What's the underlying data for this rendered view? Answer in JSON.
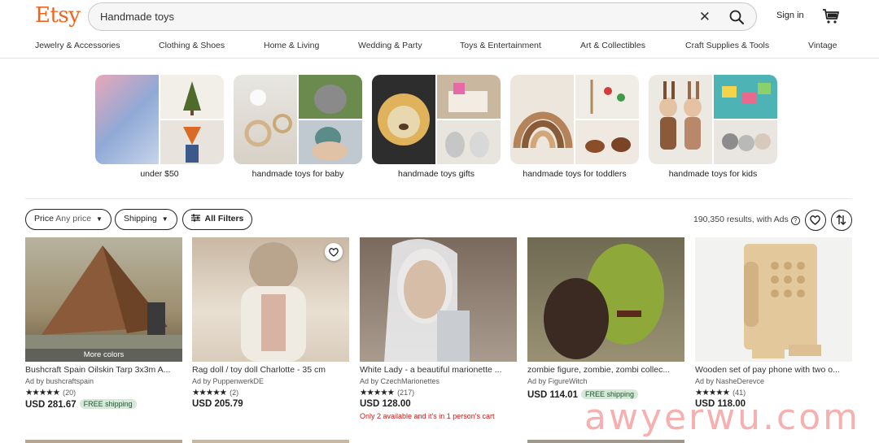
{
  "header": {
    "logo": "Etsy",
    "search_value": "Handmade toys",
    "signin": "Sign in"
  },
  "nav": [
    "Jewelry & Accessories",
    "Clothing & Shoes",
    "Home & Living",
    "Wedding & Party",
    "Toys & Entertainment",
    "Art & Collectibles",
    "Craft Supplies & Tools",
    "Vintage"
  ],
  "categories": [
    {
      "label": "under $50"
    },
    {
      "label": "handmade toys for baby"
    },
    {
      "label": "handmade toys gifts"
    },
    {
      "label": "handmade toys for toddlers"
    },
    {
      "label": "handmade toys for kids"
    }
  ],
  "filters": {
    "price_label": "Price",
    "price_value": "Any price",
    "shipping_label": "Shipping",
    "all_filters_label": "All Filters",
    "results_text": "190,350 results, with Ads"
  },
  "listings": [
    {
      "title": "Bushcraft Spain Oilskin Tarp 3x3m A...",
      "shop": "Ad by bushcraftspain",
      "stars": "★★★★★",
      "reviews": "(20)",
      "price": "USD 281.67",
      "free": "FREE shipping",
      "more_colors": "More colors"
    },
    {
      "title": "Rag doll / toy doll Charlotte - 35 cm",
      "shop": "Ad by PuppenwerkDE",
      "stars": "★★★★★",
      "reviews": "(2)",
      "price": "USD 205.79"
    },
    {
      "title": "White Lady - a beautiful marionette ...",
      "shop": "Ad by CzechMarionettes",
      "stars": "★★★★★",
      "reviews": "(217)",
      "price": "USD 128.00",
      "stock": "Only 2 available and it's in 1 person's cart"
    },
    {
      "title": "zombie figure, zombie, zombi collec...",
      "shop": "Ad by FigureWitch",
      "price": "USD 114.01",
      "free": "FREE shipping"
    },
    {
      "title": "Wooden set of pay phone with two o...",
      "shop": "Ad by NasheDerevce",
      "stars": "★★★★★",
      "reviews": "(41)",
      "price": "USD 118.00"
    }
  ],
  "watermark": "awyerwu.com",
  "colors": {
    "brand": "#f1641e",
    "free_shipping_bg": "#d4e9d7",
    "stock_warning": "#c21d1d"
  }
}
